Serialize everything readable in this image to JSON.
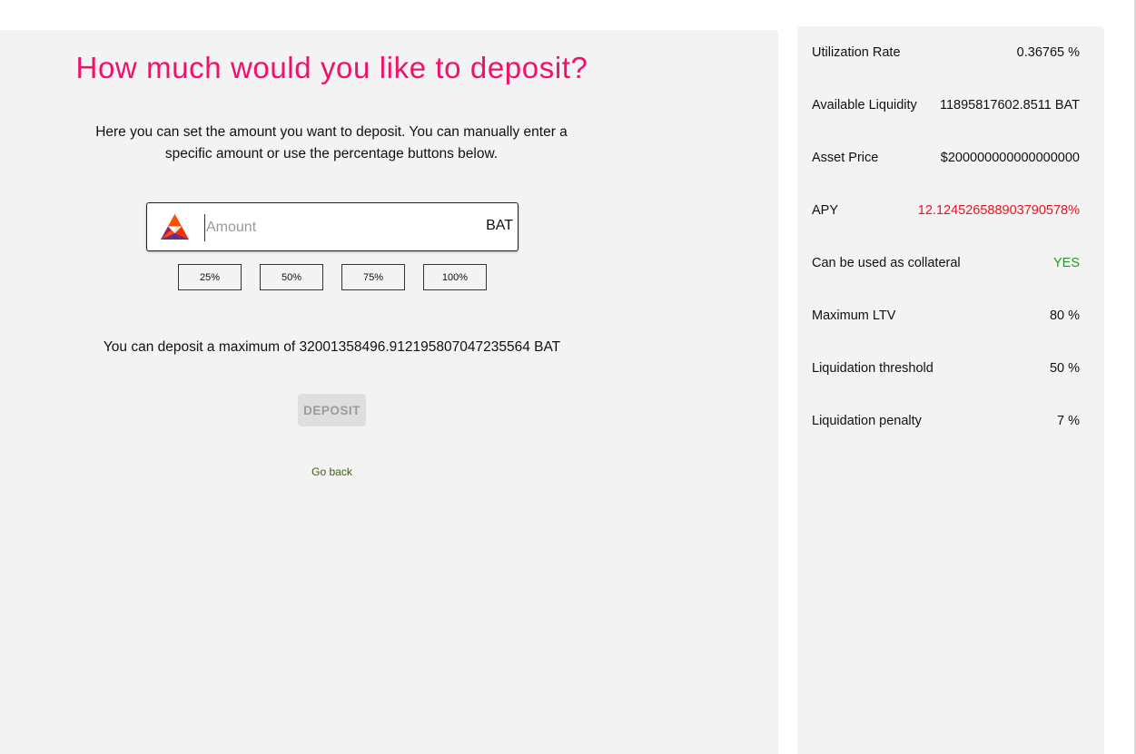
{
  "deposit": {
    "title": "How much would you like to deposit?",
    "description": "Here you can set the amount you want to deposit. You can manually enter a specific amount or use the percentage buttons below.",
    "amount_placeholder": "Amount",
    "amount_value": "",
    "unit": "BAT",
    "asset_icon": "bat-logo-icon",
    "percent_buttons": [
      "25%",
      "50%",
      "75%",
      "100%"
    ],
    "max_text": "You can deposit a maximum of 32001358496.912195807047235564 BAT",
    "deposit_button_label": "DEPOSIT",
    "deposit_button_disabled": true,
    "go_back_label": "Go back"
  },
  "stats": [
    {
      "label": "Utilization Rate",
      "value": "0.36765 %",
      "value_color": "#111111"
    },
    {
      "label": "Available Liquidity",
      "value": "11895817602.8511 BAT",
      "value_color": "#111111"
    },
    {
      "label": "Asset Price",
      "value": "$200000000000000000",
      "value_color": "#111111"
    },
    {
      "label": "APY",
      "value": "12.124526588903790578%",
      "value_color": "#e8141d"
    },
    {
      "label": "Can be used as collateral",
      "value": "YES",
      "value_color": "#1f9d1f"
    },
    {
      "label": "Maximum LTV",
      "value": "80 %",
      "value_color": "#111111"
    },
    {
      "label": "Liquidation threshold",
      "value": "50 %",
      "value_color": "#111111"
    },
    {
      "label": "Liquidation penalty",
      "value": "7 %",
      "value_color": "#111111"
    }
  ],
  "colors": {
    "title": "#f2106a",
    "panel_bg": "#f3f3f3",
    "apy": "#e8141d",
    "collateral_yes": "#1f9d1f",
    "go_back": "#3b5b12"
  }
}
